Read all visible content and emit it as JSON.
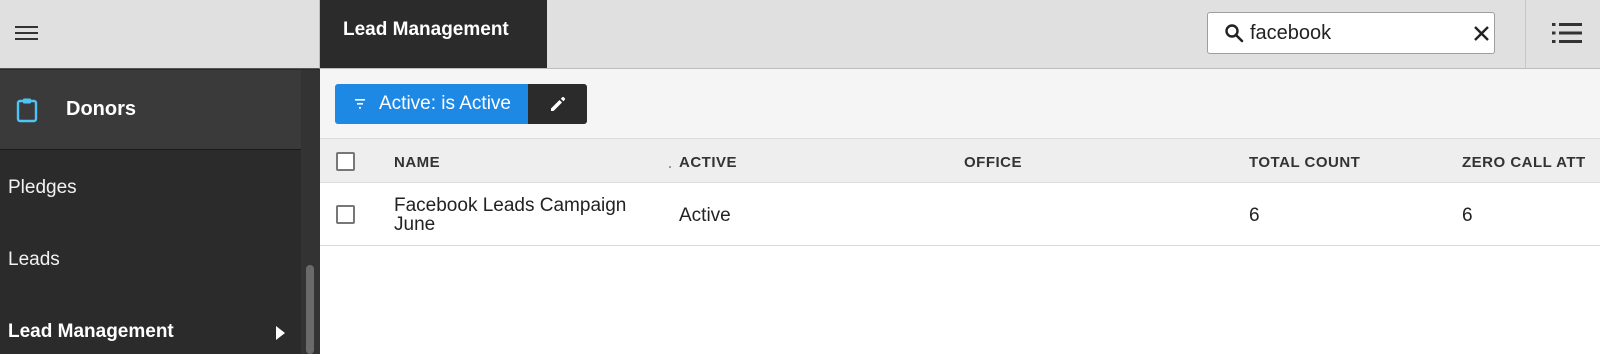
{
  "sidebar": {
    "section_title": "Donors",
    "items": [
      {
        "label": "Pledges"
      },
      {
        "label": "Leads"
      },
      {
        "label": "Lead Management"
      }
    ]
  },
  "header": {
    "active_tab": "Lead Management",
    "search": {
      "value": "facebook"
    }
  },
  "filter": {
    "label": "Active: is Active"
  },
  "table": {
    "columns": [
      "NAME",
      "ACTIVE",
      "OFFICE",
      "TOTAL COUNT",
      "ZERO CALL ATT"
    ],
    "rows": [
      {
        "name": "Facebook Leads Campaign June",
        "active": "Active",
        "office": "",
        "total_count": "6",
        "zero_call": "6"
      }
    ]
  },
  "colors": {
    "accent": "#1e88e5",
    "sidebar_bg": "#2b2b2b",
    "donors_icon": "#4fc3f7"
  }
}
